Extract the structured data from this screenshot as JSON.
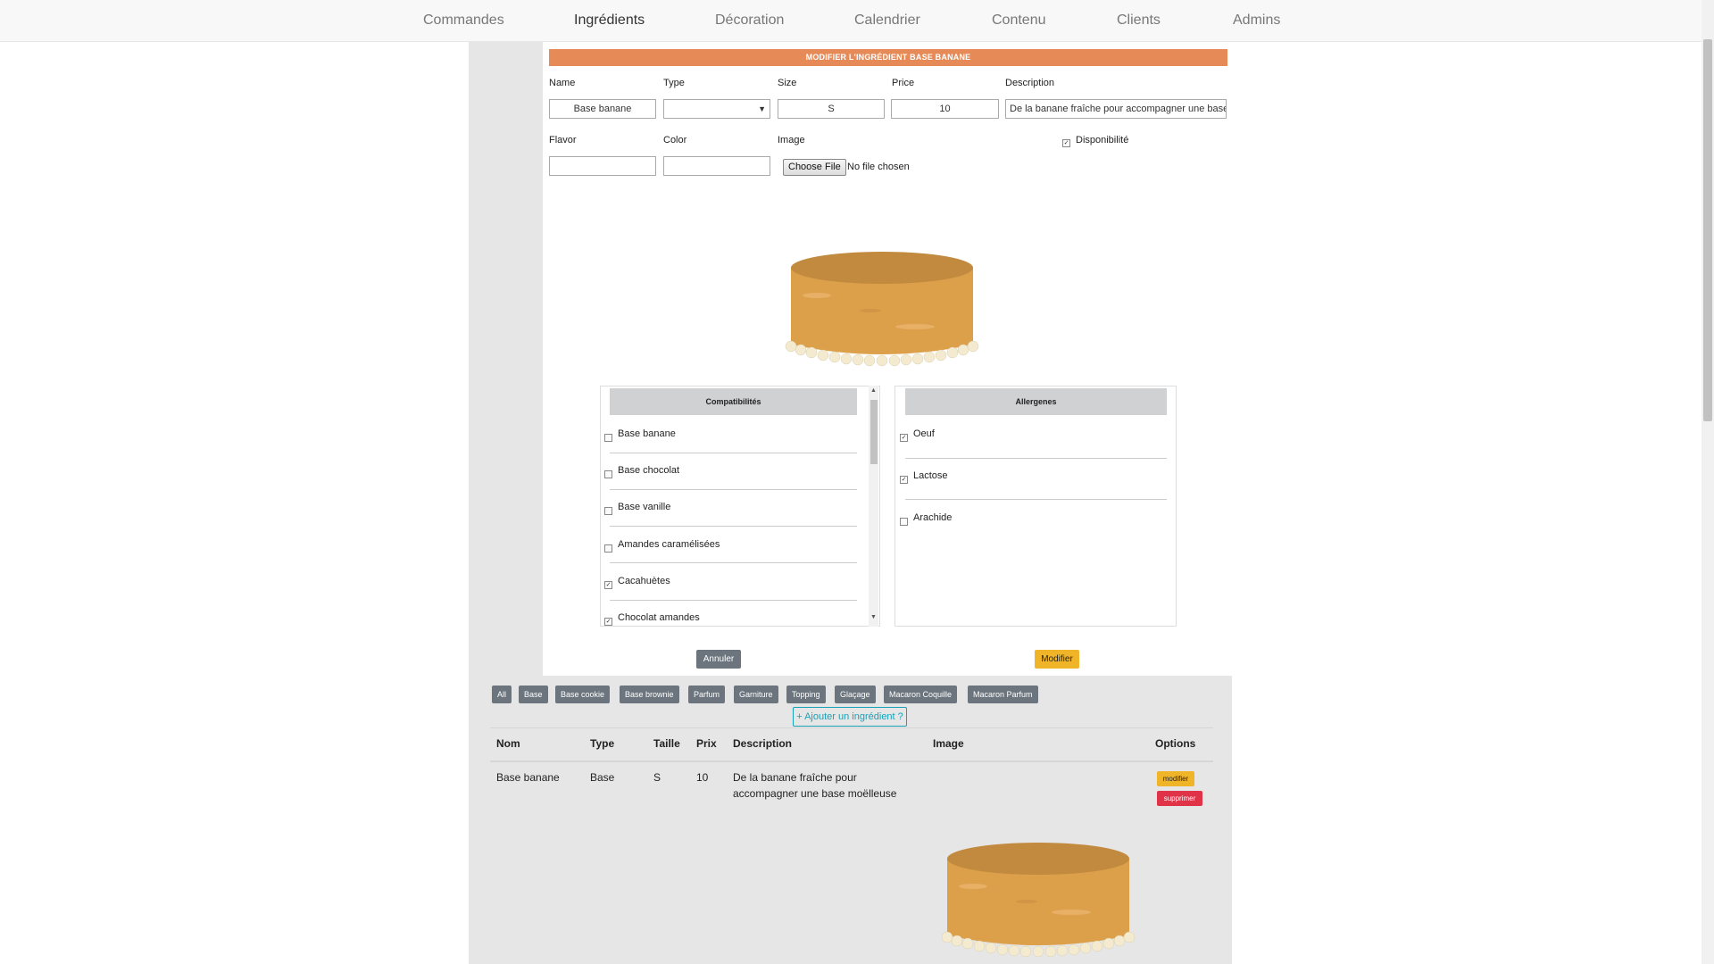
{
  "nav": {
    "items": [
      {
        "label": "Commandes",
        "active": false
      },
      {
        "label": "Ingrédients",
        "active": true
      },
      {
        "label": "Décoration",
        "active": false
      },
      {
        "label": "Calendrier",
        "active": false
      },
      {
        "label": "Contenu",
        "active": false
      },
      {
        "label": "Clients",
        "active": false
      },
      {
        "label": "Admins",
        "active": false
      }
    ]
  },
  "form": {
    "title": "MODIFIER L'INGRÉDIENT BASE BANANE",
    "labels": {
      "name": "Name",
      "type": "Type",
      "size": "Size",
      "price": "Price",
      "description": "Description",
      "flavor": "Flavor",
      "color": "Color",
      "image": "Image",
      "availability": "Disponibilité"
    },
    "values": {
      "name": "Base banane",
      "type": "",
      "size": "S",
      "price": "10",
      "description": "De la banane fraîche pour accompagner une base",
      "flavor": "",
      "color": ""
    },
    "availability_checked": true,
    "file": {
      "button": "Choose File",
      "status": "No file chosen"
    },
    "compat": {
      "title": "Compatibilités",
      "items": [
        {
          "label": "Base banane",
          "checked": false
        },
        {
          "label": "Base chocolat",
          "checked": false
        },
        {
          "label": "Base vanille",
          "checked": false
        },
        {
          "label": "Amandes caramélisées",
          "checked": false
        },
        {
          "label": "Cacahuètes",
          "checked": true
        },
        {
          "label": "Chocolat amandes",
          "checked": true
        }
      ]
    },
    "allergens": {
      "title": "Allergenes",
      "items": [
        {
          "label": "Oeuf",
          "checked": true
        },
        {
          "label": "Lactose",
          "checked": true
        },
        {
          "label": "Arachide",
          "checked": false
        }
      ]
    },
    "cancel_label": "Annuler",
    "submit_label": "Modifier"
  },
  "filters": [
    "All",
    "Base",
    "Base cookie",
    "Base brownie",
    "Parfum",
    "Garniture",
    "Topping",
    "Glaçage",
    "Macaron Coquille",
    "Macaron Parfum"
  ],
  "add_label": "+ Ajouter un ingrédient ?",
  "table": {
    "headers": [
      "Nom",
      "Type",
      "Taille",
      "Prix",
      "Description",
      "Image",
      "Options"
    ],
    "rows": [
      {
        "nom": "Base banane",
        "type": "Base",
        "taille": "S",
        "prix": "10",
        "description": "De la banane fraîche pour accompagner une base moëlleuse",
        "edit_label": "modifier",
        "delete_label": "supprimer"
      }
    ]
  },
  "colors": {
    "title_bar": "#e68a57",
    "warning": "#f0b429",
    "danger": "#e03348",
    "secondary": "#6c757d",
    "info": "#17a2b8",
    "cake": "#dda04a"
  }
}
